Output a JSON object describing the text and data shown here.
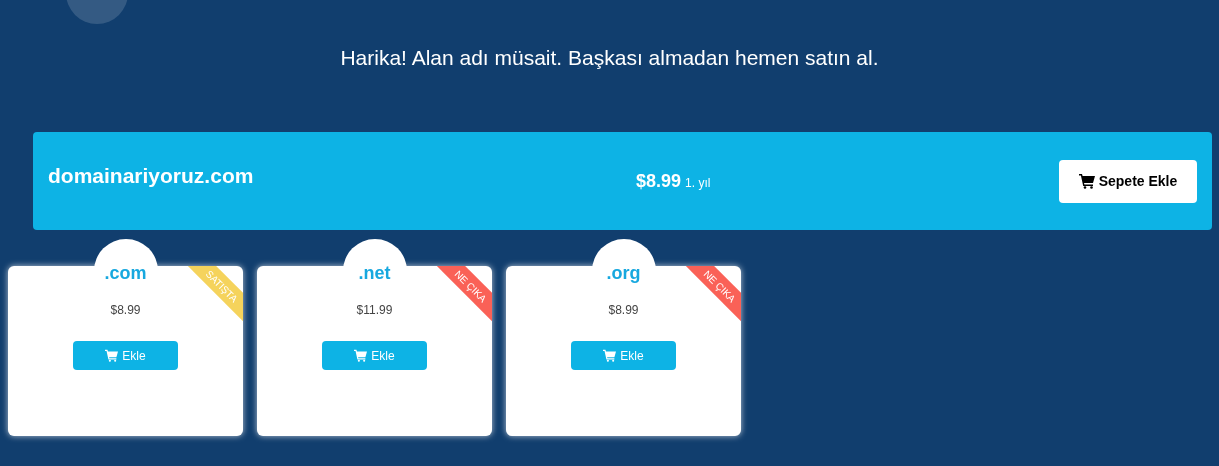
{
  "headline": "Harika! Alan adı müsait. Başkası almadan hemen satın al.",
  "result": {
    "domain": "domainariyoruz.com",
    "price": "$8.99",
    "period": "1. yıl",
    "button": "Sepete Ekle"
  },
  "extensions": [
    {
      "name": ".com",
      "price": "$8.99",
      "button": "Ekle",
      "ribbon": "SATIŞTA",
      "color": "#f5d35c"
    },
    {
      "name": ".net",
      "price": "$11.99",
      "button": "Ekle",
      "ribbon": "NE ÇIKA",
      "color": "#fa6157"
    },
    {
      "name": ".org",
      "price": "$8.99",
      "button": "Ekle",
      "ribbon": "NE ÇIKA",
      "color": "#fa6157"
    }
  ]
}
